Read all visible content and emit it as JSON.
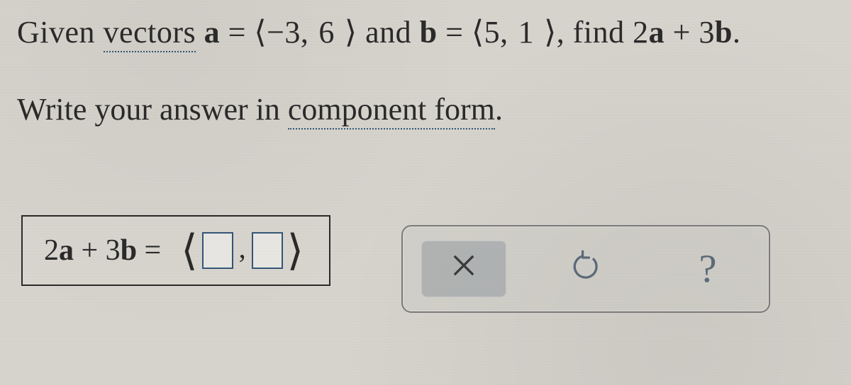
{
  "problem": {
    "prefix": "Given ",
    "link_vectors": "vectors",
    "text_a_eq": " a = ",
    "vec_a_open": "⟨",
    "vec_a_x": "−3",
    "vec_a_sep": ",",
    "vec_a_y": "6",
    "vec_a_close": "⟩",
    "text_and": " and ",
    "text_b_eq": "b = ",
    "vec_b_open": "⟨",
    "vec_b_x": "5",
    "vec_b_sep": ",",
    "vec_b_y": "1",
    "vec_b_close": "⟩",
    "text_find": ", find 2",
    "text_a": "a",
    "text_plus": " + 3",
    "text_b": "b",
    "text_period": "."
  },
  "instruction": {
    "prefix": "Write your answer in ",
    "link_component": "component form",
    "suffix": "."
  },
  "answer": {
    "lhs_2": "2",
    "lhs_a": "a",
    "lhs_plus": " + 3",
    "lhs_b": "b",
    "lhs_eq": " = ",
    "open": "⟨",
    "sep": ",",
    "close": "⟩",
    "slot1_value": "",
    "slot2_value": ""
  },
  "controls": {
    "close_label": "close",
    "reset_label": "reset",
    "help_label": "help",
    "help_glyph": "?"
  }
}
